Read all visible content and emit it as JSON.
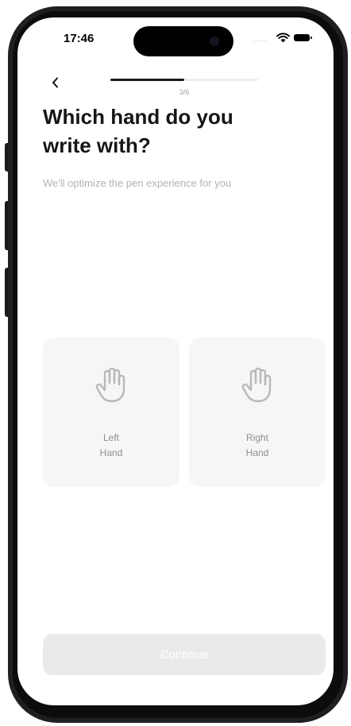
{
  "status_bar": {
    "time": "17:46",
    "signal": "....."
  },
  "onboarding": {
    "step_label": "3/6",
    "progress_fraction": 0.5,
    "title_line1": "Which hand do you",
    "title_line2": "write with?",
    "subtitle": "We'll optimize the pen experience for you"
  },
  "options": [
    {
      "line1": "Left",
      "line2": "Hand",
      "icon": "hand-icon"
    },
    {
      "line1": "Right",
      "line2": "Hand",
      "icon": "hand-icon"
    }
  ],
  "footer": {
    "continue_label": "Continue"
  },
  "colors": {
    "accent": "#1a1a1a",
    "card_background": "#f6f6f6",
    "button_disabled": "#eaeaea",
    "subtitle_text": "#b3b3b3"
  }
}
